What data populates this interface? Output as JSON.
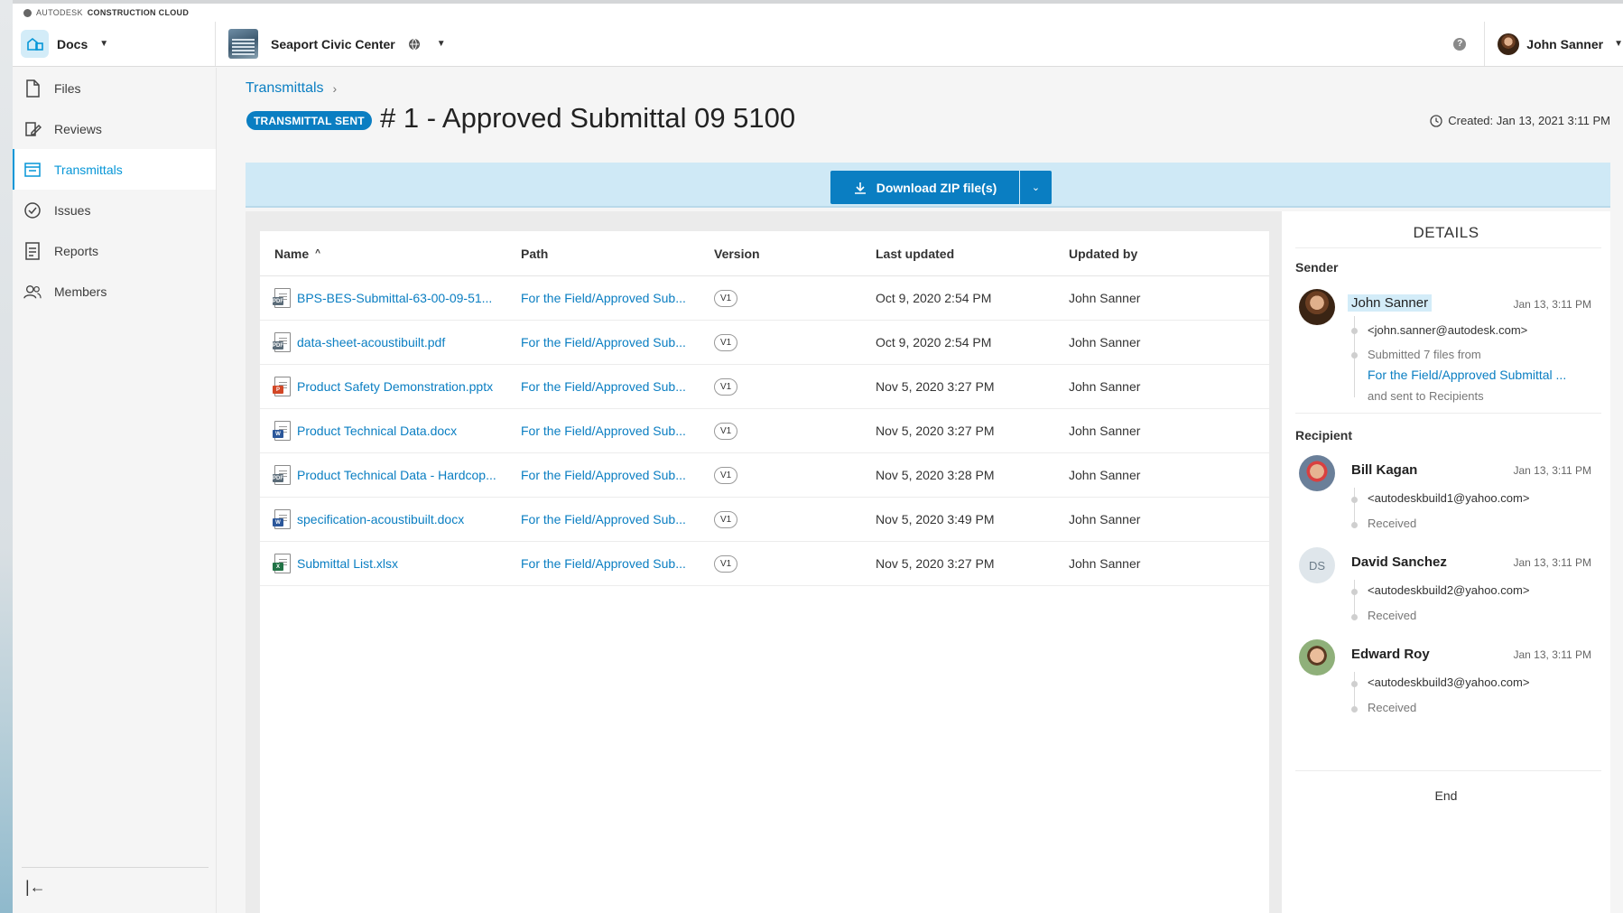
{
  "brand": "AUTODESK CONSTRUCTION CLOUD",
  "brand_prefix": "AUTODESK",
  "brand_suffix": "CONSTRUCTION CLOUD",
  "header": {
    "module": "Docs",
    "project": "Seaport Civic Center",
    "user": "John Sanner"
  },
  "sidebar": {
    "items": [
      {
        "label": "Files",
        "icon": "file-icon"
      },
      {
        "label": "Reviews",
        "icon": "reviews-icon"
      },
      {
        "label": "Transmittals",
        "icon": "transmittals-icon",
        "active": true
      },
      {
        "label": "Issues",
        "icon": "issues-icon"
      },
      {
        "label": "Reports",
        "icon": "reports-icon"
      },
      {
        "label": "Members",
        "icon": "members-icon"
      }
    ]
  },
  "breadcrumb": {
    "root": "Transmittals",
    "sep": "›"
  },
  "status_badge": "TRANSMITTAL SENT",
  "title": "# 1 - Approved Submittal 09 5100",
  "created": "Created: Jan 13, 2021 3:11 PM",
  "download": {
    "label": "Download ZIP file(s)"
  },
  "table": {
    "headers": {
      "name": "Name",
      "path": "Path",
      "version": "Version",
      "updated": "Last updated",
      "by": "Updated by"
    },
    "rows": [
      {
        "name": "BPS-BES-Submittal-63-00-09-51...",
        "type": "pdf",
        "path": "For the Field/Approved Sub...",
        "version": "V1",
        "updated": "Oct 9, 2020 2:54 PM",
        "by": "John Sanner"
      },
      {
        "name": "data-sheet-acoustibuilt.pdf",
        "type": "pdf",
        "path": "For the Field/Approved Sub...",
        "version": "V1",
        "updated": "Oct 9, 2020 2:54 PM",
        "by": "John Sanner"
      },
      {
        "name": "Product Safety Demonstration.pptx",
        "type": "pptx",
        "path": "For the Field/Approved Sub...",
        "version": "V1",
        "updated": "Nov 5, 2020 3:27 PM",
        "by": "John Sanner"
      },
      {
        "name": "Product Technical Data.docx",
        "type": "docx",
        "path": "For the Field/Approved Sub...",
        "version": "V1",
        "updated": "Nov 5, 2020 3:27 PM",
        "by": "John Sanner"
      },
      {
        "name": "Product Technical Data - Hardcop...",
        "type": "pdf",
        "path": "For the Field/Approved Sub...",
        "version": "V1",
        "updated": "Nov 5, 2020 3:28 PM",
        "by": "John Sanner"
      },
      {
        "name": "specification-acoustibuilt.docx",
        "type": "docx",
        "path": "For the Field/Approved Sub...",
        "version": "V1",
        "updated": "Nov 5, 2020 3:49 PM",
        "by": "John Sanner"
      },
      {
        "name": "Submittal List.xlsx",
        "type": "xlsx",
        "path": "For the Field/Approved Sub...",
        "version": "V1",
        "updated": "Nov 5, 2020 3:27 PM",
        "by": "John Sanner"
      }
    ]
  },
  "details": {
    "title": "DETAILS",
    "sender_label": "Sender",
    "sender": {
      "name": "John Sanner",
      "date": "Jan 13, 3:11 PM",
      "email": "<john.sanner@autodesk.com>",
      "submitted": "Submitted 7 files from",
      "folder": "For the Field/Approved Submittal ...",
      "sent_to": "and sent to Recipients"
    },
    "recipient_label": "Recipient",
    "recipients": [
      {
        "name": "Bill Kagan",
        "date": "Jan 13, 3:11 PM",
        "email": "<autodeskbuild1@yahoo.com>",
        "status": "Received"
      },
      {
        "name": "David Sanchez",
        "initials": "DS",
        "date": "Jan 13, 3:11 PM",
        "email": "<autodeskbuild2@yahoo.com>",
        "status": "Received"
      },
      {
        "name": "Edward Roy",
        "date": "Jan 13, 3:11 PM",
        "email": "<autodeskbuild3@yahoo.com>",
        "status": "Received"
      }
    ],
    "end": "End"
  },
  "colors": {
    "accent": "#0a7ec2",
    "active_nav": "#0696d7",
    "download_bar": "#cfe9f6"
  }
}
